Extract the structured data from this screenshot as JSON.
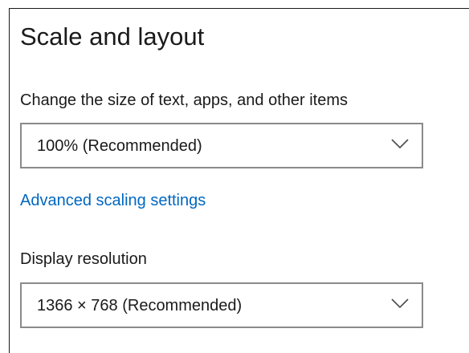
{
  "section": {
    "title": "Scale and layout"
  },
  "scale": {
    "label": "Change the size of text, apps, and other items",
    "selected": "100% (Recommended)",
    "chevron_icon": "chevron-down-icon"
  },
  "advanced_link": "Advanced scaling settings",
  "resolution": {
    "label": "Display resolution",
    "selected": "1366 × 768 (Recommended)",
    "chevron_icon": "chevron-down-icon"
  },
  "colors": {
    "link": "#0067c0",
    "text": "#1a1a1a",
    "dropdown_border": "#8a8a8a"
  }
}
